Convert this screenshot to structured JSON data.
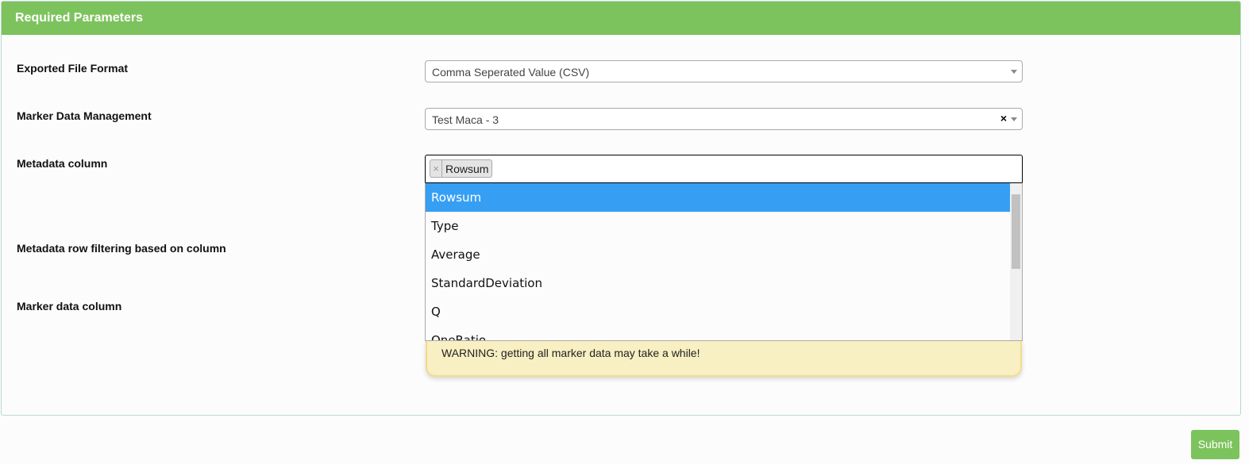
{
  "panel": {
    "title": "Required Parameters"
  },
  "fields": {
    "file_format": {
      "label": "Exported File Format",
      "value": "Comma Seperated Value (CSV)"
    },
    "marker_mgmt": {
      "label": "Marker Data Management",
      "value": "Test Maca - 3",
      "clear": "×"
    },
    "metadata_column": {
      "label": "Metadata column",
      "selected_tag": "Rowsum",
      "tag_remove": "×",
      "options": [
        "Rowsum",
        "Type",
        "Average",
        "StandardDeviation",
        "Q",
        "OneRatio"
      ],
      "highlighted": "Rowsum"
    },
    "row_filtering": {
      "label": "Metadata row filtering based on column"
    },
    "marker_data_column": {
      "label": "Marker data column",
      "warning": "WARNING: getting all marker data may take a while!"
    }
  },
  "submit_label": "Submit",
  "colors": {
    "header": "#7dc35d",
    "highlight": "#369ff4",
    "warning_bg": "#f8efc2"
  }
}
